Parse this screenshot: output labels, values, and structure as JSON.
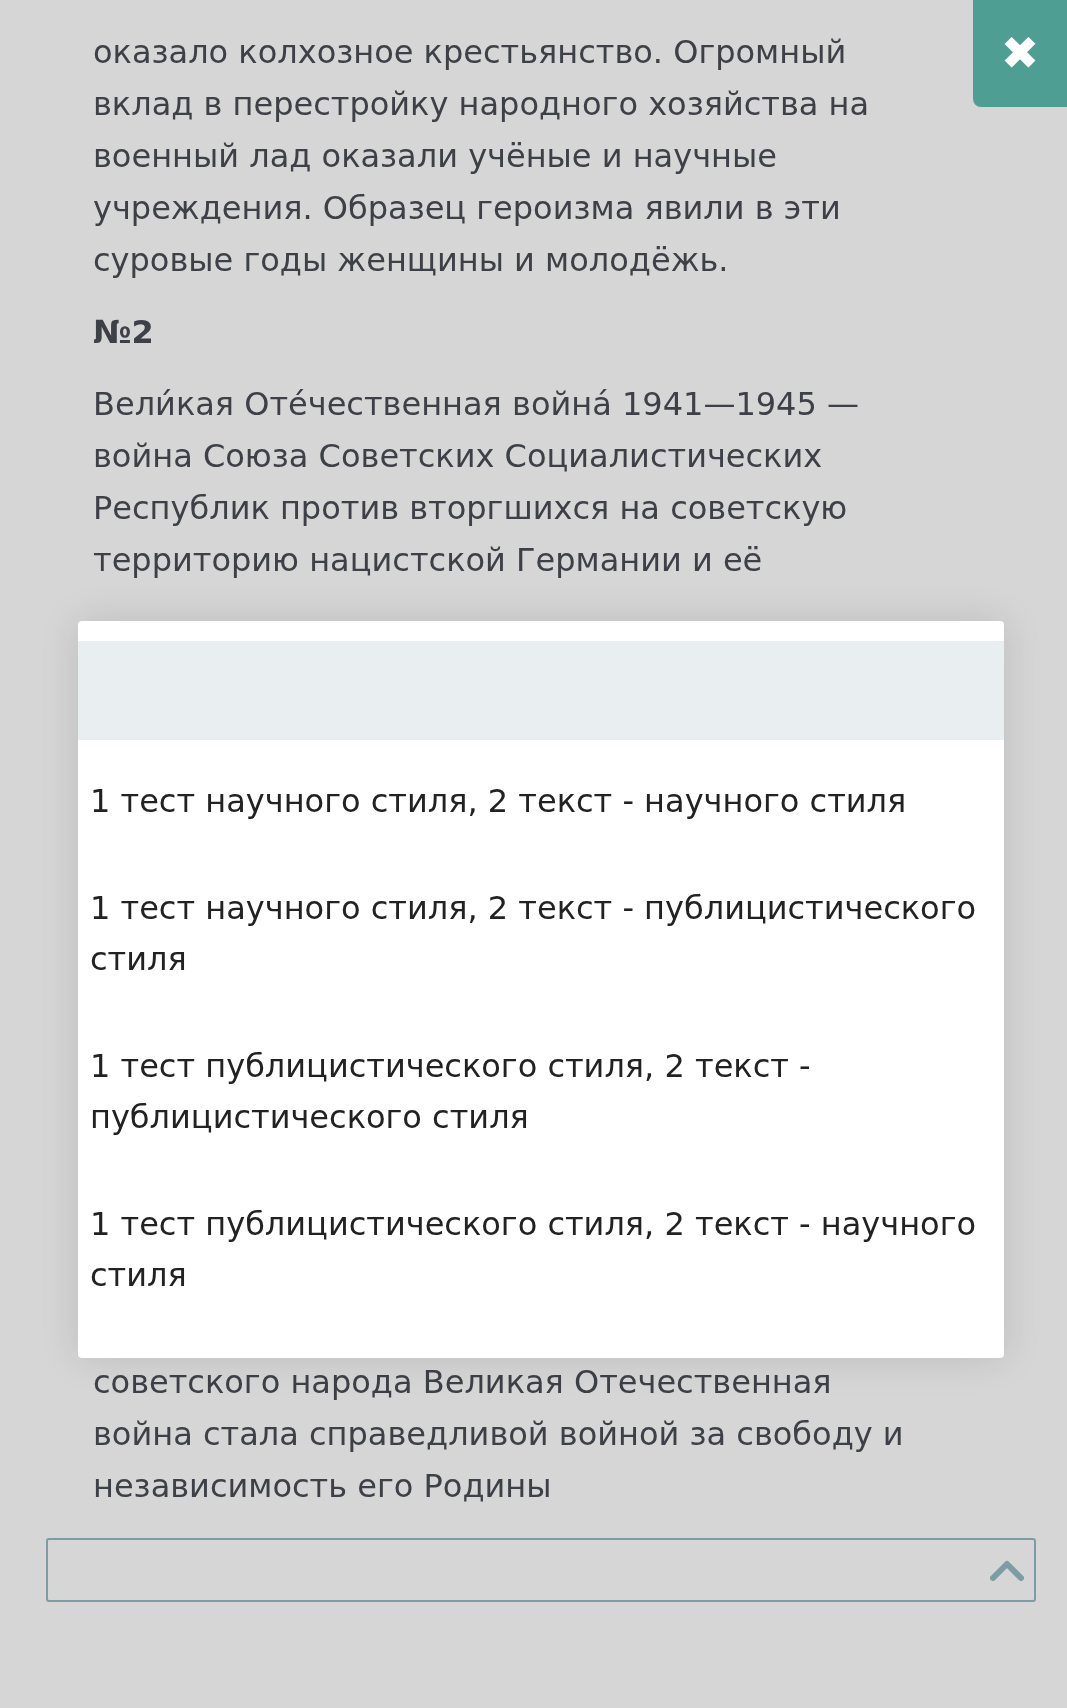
{
  "passage_1": {
    "text": "оказало колхозное крестьянство. Огромный вклад в перестройку народного хозяйства на военный лад оказали учёные и научные учреждения. Образец героизма явили в эти суровые годы женщины и молодёжь."
  },
  "heading": "№2",
  "passage_2": {
    "text": "Вели́кая Оте́чественная войнá 1941—1945 — война Союза Советских Социалистических Республик против вторгшихся на советскую территорию нацистской Германии и её"
  },
  "passage_3": {
    "text": "советского народа Великая Отечественная война стала справедливой войной за свободу и независимость его Родины"
  },
  "close_button": {
    "label": "✖"
  },
  "answer_select": {
    "expanded": true
  },
  "dropdown": {
    "options": [
      {
        "label": "1 тест научного стиля, 2 текст - научного стиля",
        "selected": false
      },
      {
        "label": "1 тест научного стиля, 2 текст - публицистического стиля",
        "selected": false
      },
      {
        "label": "1 тест публицистического стиля, 2 текст - публицистического стиля",
        "selected": false
      },
      {
        "label": "1 тест публицистического стиля, 2 текст - научного стиля",
        "selected": false
      }
    ]
  }
}
